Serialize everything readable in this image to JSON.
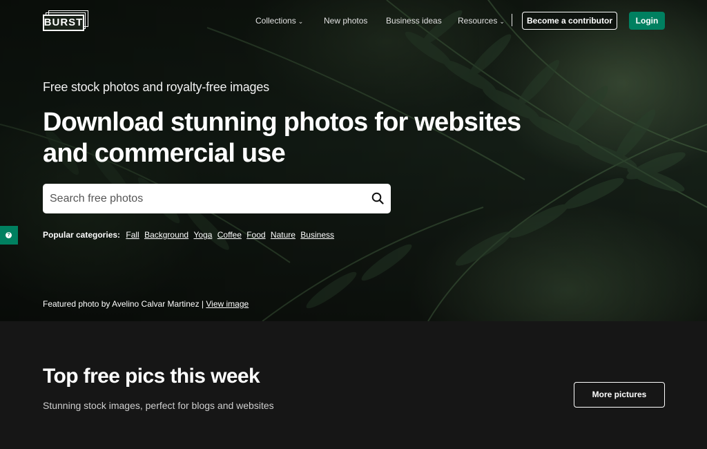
{
  "header": {
    "logo_text": "BURST",
    "nav": [
      {
        "label": "Collections",
        "dropdown": true
      },
      {
        "label": "New photos",
        "dropdown": false
      },
      {
        "label": "Business ideas",
        "dropdown": false
      },
      {
        "label": "Resources",
        "dropdown": true
      }
    ],
    "contributor_label": "Become a contributor",
    "login_label": "Login"
  },
  "hero": {
    "eyebrow": "Free stock photos and royalty-free images",
    "headline": "Download stunning photos for websites and commercial use",
    "search_placeholder": "Search free photos",
    "popular_label": "Popular categories:",
    "categories": [
      "Fall",
      "Background",
      "Yoga",
      "Coffee",
      "Food",
      "Nature",
      "Business"
    ],
    "credit_prefix": "Featured photo by Avelino Calvar Martinez |",
    "credit_link": "View image"
  },
  "top_pics": {
    "title": "Top free pics this week",
    "subtitle": "Stunning stock images, perfect for blogs and websites",
    "more_label": "More pictures"
  },
  "colors": {
    "accent_green": "#008060",
    "section_bg": "#161616"
  },
  "icons": {
    "search": "search-icon",
    "chevron": "chevron-down-icon",
    "feedback": "feedback-icon"
  }
}
